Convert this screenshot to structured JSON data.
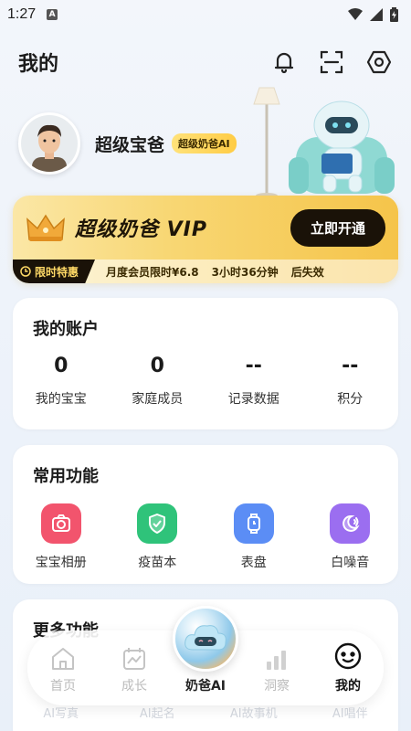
{
  "status_bar": {
    "time": "1:27",
    "notif_badge": "A"
  },
  "header": {
    "title": "我的"
  },
  "profile": {
    "username": "超级宝爸",
    "badge": "超级奶爸AI"
  },
  "vip": {
    "title": "超级奶爸 VIP",
    "button": "立即开通",
    "promo_tag": "限时特惠",
    "promo_items": [
      "月度会员限时¥6.8",
      "3小时36分钟",
      "后失效"
    ]
  },
  "account": {
    "title": "我的账户",
    "stats": [
      {
        "value": "0",
        "label": "我的宝宝"
      },
      {
        "value": "0",
        "label": "家庭成员"
      },
      {
        "value": "--",
        "label": "记录数据"
      },
      {
        "value": "--",
        "label": "积分"
      }
    ]
  },
  "functions": {
    "title": "常用功能",
    "items": [
      {
        "label": "宝宝相册",
        "icon": "camera-icon",
        "color": "#f2546d"
      },
      {
        "label": "疫苗本",
        "icon": "shield-check-icon",
        "color": "#2fc37a"
      },
      {
        "label": "表盘",
        "icon": "watch-icon",
        "color": "#5b8df5"
      },
      {
        "label": "白噪音",
        "icon": "moon-sound-icon",
        "color": "#9b6ef0"
      }
    ]
  },
  "more": {
    "title": "更多功能",
    "items": [
      "AI写真",
      "AI起名",
      "AI故事机",
      "AI唱伴"
    ]
  },
  "tabbar": {
    "items": [
      {
        "label": "首页",
        "icon": "home-icon"
      },
      {
        "label": "成长",
        "icon": "growth-chart-icon"
      },
      {
        "label": "奶爸AI",
        "icon": "cloud-mascot-icon"
      },
      {
        "label": "洞察",
        "icon": "bar-chart-icon"
      },
      {
        "label": "我的",
        "icon": "smiley-icon"
      }
    ],
    "active": "我的"
  }
}
